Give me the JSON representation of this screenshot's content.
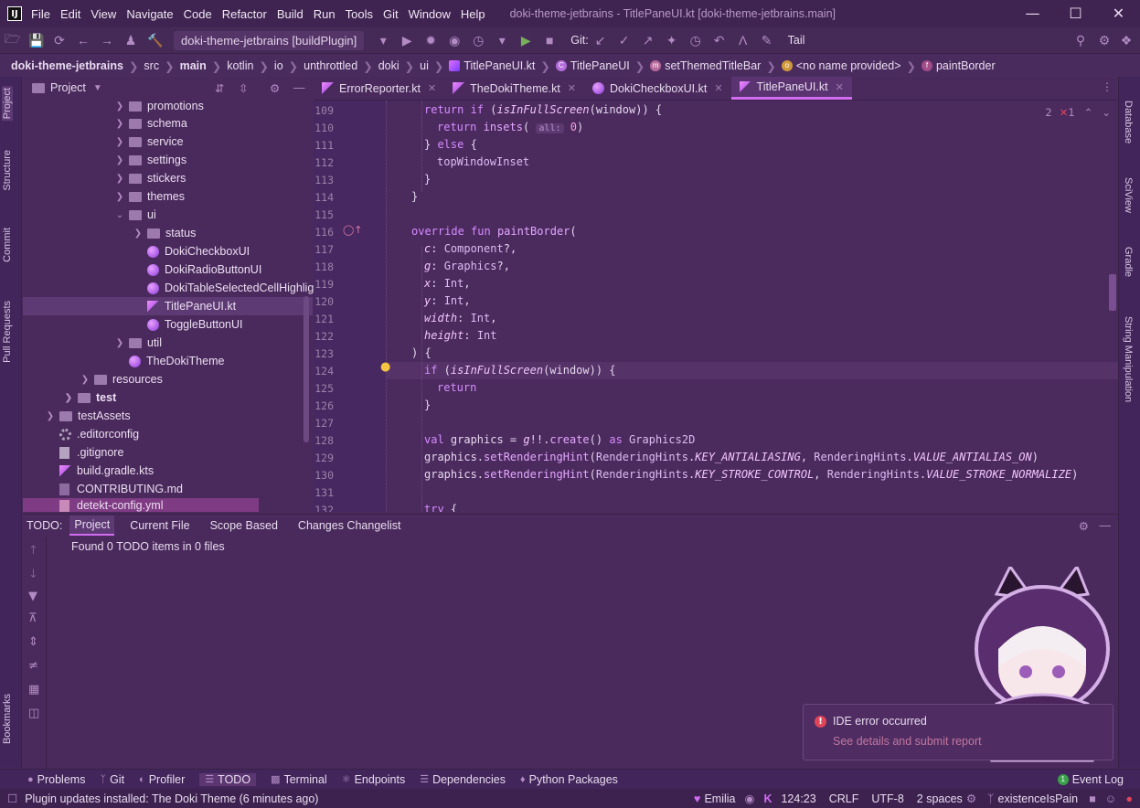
{
  "titlebar": {
    "menu": [
      "File",
      "Edit",
      "View",
      "Navigate",
      "Code",
      "Refactor",
      "Build",
      "Run",
      "Tools",
      "Git",
      "Window",
      "Help"
    ],
    "window_title": "doki-theme-jetbrains - TitlePaneUI.kt [doki-theme-jetbrains.main]"
  },
  "toolbar": {
    "run_config": "doki-theme-jetbrains [buildPlugin]",
    "git_label": "Git:",
    "tail_label": "Tail"
  },
  "breadcrumbs": {
    "items": [
      "doki-theme-jetbrains",
      "src",
      "main",
      "kotlin",
      "io",
      "unthrottled",
      "doki",
      "ui",
      "TitlePaneUI.kt",
      "TitlePaneUI",
      "setThemedTitleBar",
      "<no name provided>",
      "paintBorder"
    ]
  },
  "left_stripe": {
    "project": "Project",
    "structure": "Structure",
    "commit": "Commit",
    "pull_requests": "Pull Requests",
    "bookmarks": "Bookmarks"
  },
  "right_stripe": {
    "database": "Database",
    "sciview": "SciView",
    "gradle": "Gradle",
    "string_manipulation": "String Manipulation"
  },
  "project_panel": {
    "title": "Project",
    "items": [
      "promotions",
      "schema",
      "service",
      "settings",
      "stickers",
      "themes",
      "ui",
      "status",
      "DokiCheckboxUI",
      "DokiRadioButtonUI",
      "DokiTableSelectedCellHighlight",
      "TitlePaneUI.kt",
      "ToggleButtonUI",
      "util",
      "TheDokiTheme",
      "resources",
      "test",
      "testAssets",
      ".editorconfig",
      ".gitignore",
      "build.gradle.kts",
      "CONTRIBUTING.md",
      "detekt-config.yml"
    ]
  },
  "editor_tabs": [
    "ErrorReporter.kt",
    "TheDokiTheme.kt",
    "DokiCheckboxUI.kt",
    "TitlePaneUI.kt"
  ],
  "editor": {
    "line_numbers": [
      "109",
      "110",
      "111",
      "112",
      "113",
      "114",
      "115",
      "116",
      "117",
      "118",
      "119",
      "120",
      "121",
      "122",
      "123",
      "124",
      "125",
      "126",
      "127",
      "128",
      "129",
      "130",
      "131",
      "132"
    ],
    "inspection_warnings": "2",
    "inspection_weak": "1"
  },
  "todo": {
    "label": "TODO:",
    "tabs": [
      "Project",
      "Current File",
      "Scope Based",
      "Changes Changelist"
    ],
    "message": "Found 0 TODO items in 0 files"
  },
  "bottom_tabs": [
    "Problems",
    "Git",
    "Profiler",
    "TODO",
    "Terminal",
    "Endpoints",
    "Dependencies",
    "Python Packages",
    "Event Log"
  ],
  "status": {
    "message": "Plugin updates installed: The Doki Theme (6 minutes ago)",
    "theme": "Emilia",
    "position": "124:23",
    "line_sep": "CRLF",
    "encoding": "UTF-8",
    "indent": "2 spaces",
    "branch": "existenceIsPain"
  },
  "notification": {
    "title": "IDE error occurred",
    "link": "See details and submit report"
  },
  "colors": {
    "accent": "#d26cf3",
    "background": "#4a2a5c",
    "error": "#e0455a"
  }
}
